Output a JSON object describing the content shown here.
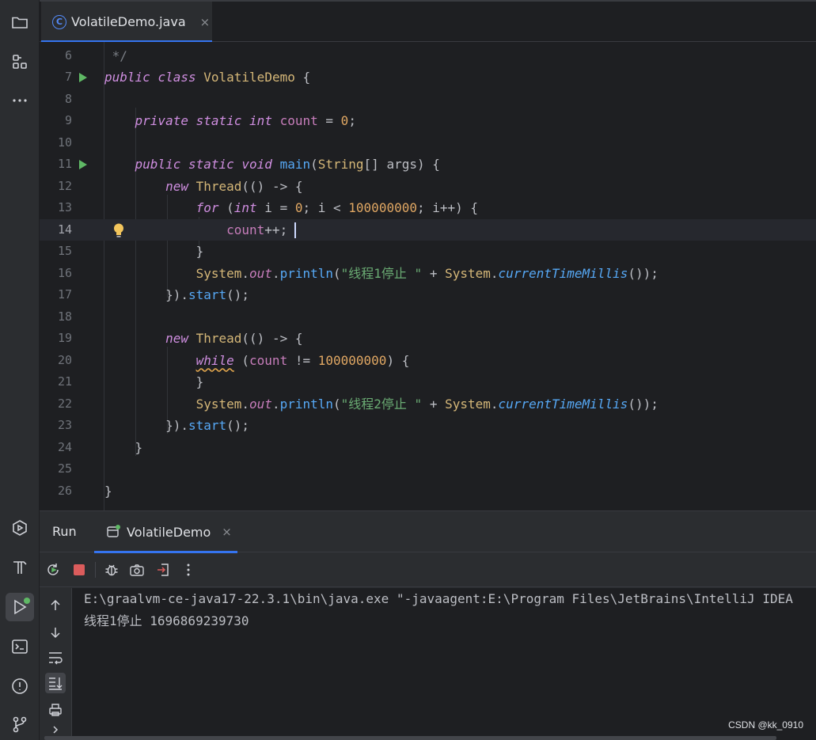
{
  "editor_tab": {
    "filename": "VolatileDemo.java",
    "icon": "class-c-icon",
    "close": "×"
  },
  "code_lines": [
    {
      "num": "6",
      "text": " */"
    },
    {
      "num": "7",
      "text": "public class VolatileDemo {"
    },
    {
      "num": "8",
      "text": ""
    },
    {
      "num": "9",
      "text": "    private static int count = 0;"
    },
    {
      "num": "10",
      "text": ""
    },
    {
      "num": "11",
      "text": "    public static void main(String[] args) {"
    },
    {
      "num": "12",
      "text": "        new Thread(() -> {"
    },
    {
      "num": "13",
      "text": "            for (int i = 0; i < 100000000; i++) {"
    },
    {
      "num": "14",
      "text": "                count++;"
    },
    {
      "num": "15",
      "text": "            }"
    },
    {
      "num": "16",
      "text": "            System.out.println(\"线程1停止 \" + System.currentTimeMillis());"
    },
    {
      "num": "17",
      "text": "        }).start();"
    },
    {
      "num": "18",
      "text": ""
    },
    {
      "num": "19",
      "text": "        new Thread(() -> {"
    },
    {
      "num": "20",
      "text": "            while (count != 100000000) {"
    },
    {
      "num": "21",
      "text": "            }"
    },
    {
      "num": "22",
      "text": "            System.out.println(\"线程2停止 \" + System.currentTimeMillis());"
    },
    {
      "num": "23",
      "text": "        }).start();"
    },
    {
      "num": "24",
      "text": "    }"
    },
    {
      "num": "25",
      "text": ""
    },
    {
      "num": "26",
      "text": "}"
    }
  ],
  "current_line": "14",
  "run_panel": {
    "title": "Run",
    "tab_label": "VolatileDemo",
    "tab_close": "×",
    "console_lines": [
      "E:\\graalvm-ce-java17-22.3.1\\bin\\java.exe \"-javaagent:E:\\Program Files\\JetBrains\\IntelliJ IDEA",
      "线程1停止 1696869239730"
    ]
  },
  "watermark": "CSDN @kk_0910",
  "colors": {
    "background": "#1e1f22",
    "panel": "#2b2d30",
    "accent": "#3574f0",
    "keyword": "#cf8ee0",
    "string": "#6aab73",
    "number": "#2aacb8",
    "method": "#56a8f5",
    "run_green": "#5fb865"
  }
}
